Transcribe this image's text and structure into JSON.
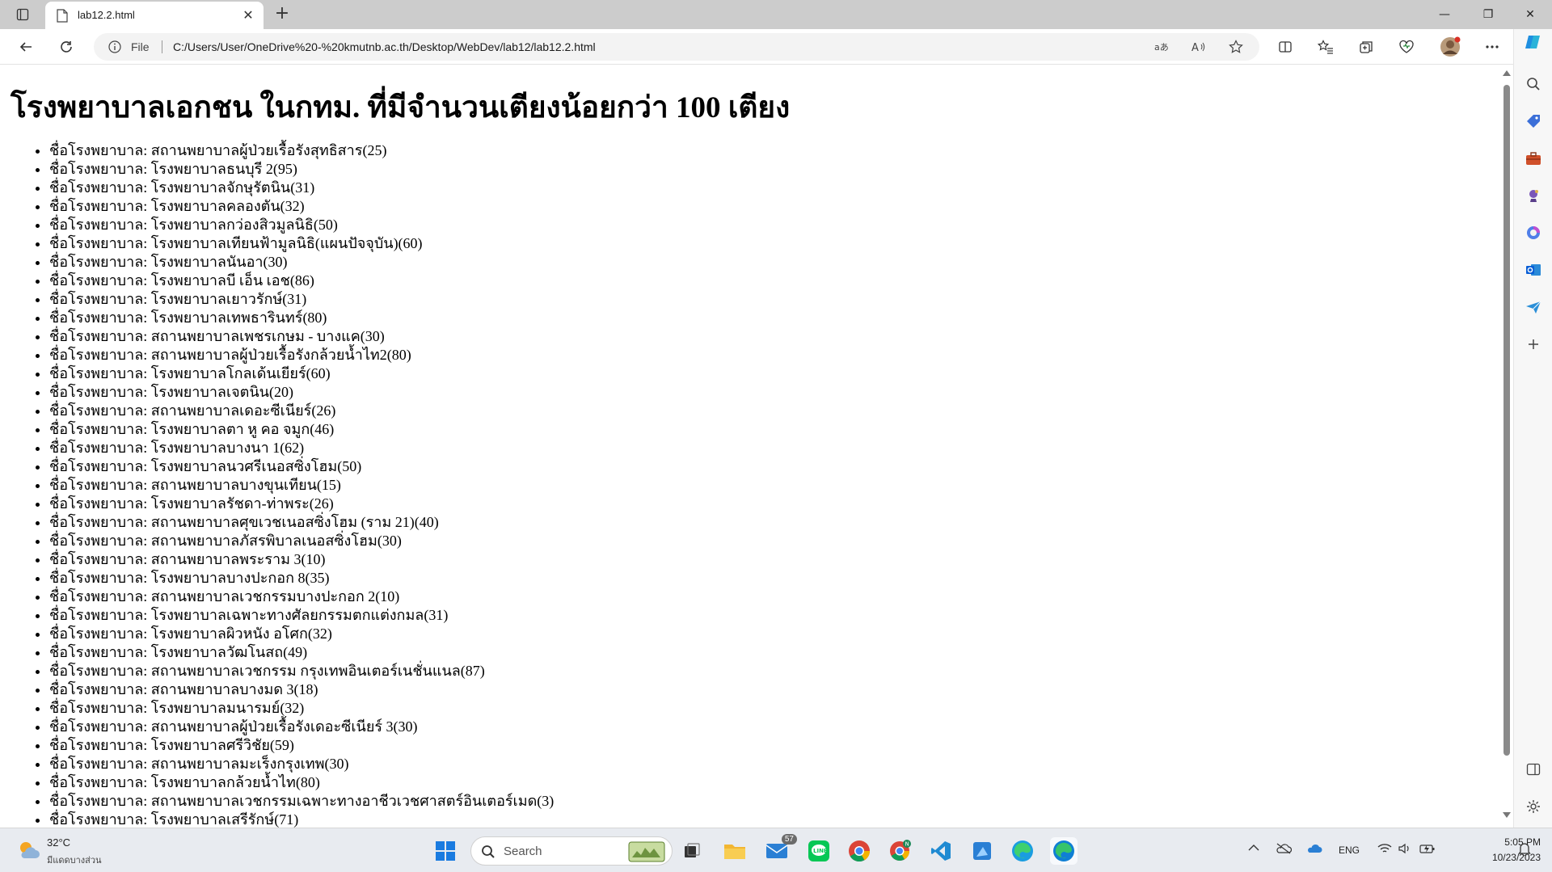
{
  "tab": {
    "title": "lab12.2.html",
    "close_glyph": "✕",
    "newtab_glyph": "+"
  },
  "window_controls": {
    "minimize": "—",
    "restore": "❐",
    "close": "✕"
  },
  "address_bar": {
    "scheme_label": "File",
    "url": "C:/Users/User/OneDrive%20-%20kmutnb.ac.th/Desktop/WebDev/lab12/lab12.2.html",
    "translate_label": "aあ",
    "read_aloud_label": "A⁠ⁿ"
  },
  "page": {
    "heading": "โรงพยาบาลเอกชน ในกทม. ที่มีจำนวนเตียงน้อยกว่า 100 เตียง",
    "item_prefix": "ชื่อโรงพยาบาล: ",
    "items": [
      "สถานพยาบาลผู้ป่วยเรื้อรังสุทธิสาร(25)",
      "โรงพยาบาลธนบุรี 2(95)",
      "โรงพยาบาลจักษุรัตนิน(31)",
      "โรงพยาบาลคลองตัน(32)",
      "โรงพยาบาลกว่องสิวมูลนิธิ(50)",
      "โรงพยาบาลเทียนฟ้ามูลนิธิ(แผนปัจจุบัน)(60)",
      "โรงพยาบาลนันอา(30)",
      "โรงพยาบาลบี เอ็น เอช(86)",
      "โรงพยาบาลเยาวรักษ์(31)",
      "โรงพยาบาลเทพธารินทร์(80)",
      "สถานพยาบาลเพชรเกษม - บางแค(30)",
      "สถานพยาบาลผู้ป่วยเรื้อรังกล้วยน้ำไท2(80)",
      "โรงพยาบาลโกลเด้นเยียร์(60)",
      "โรงพยาบาลเจตนิน(20)",
      "สถานพยาบาลเดอะซีเนียร์(26)",
      "โรงพยาบาลตา หู คอ จมูก(46)",
      "โรงพยาบาลบางนา 1(62)",
      "โรงพยาบาลนวศรีเนอสซิ่งโฮม(50)",
      "สถานพยาบาลบางขุนเทียน(15)",
      "โรงพยาบาลรัชดา-ท่าพระ(26)",
      "สถานพยาบาลศุขเวชเนอสซิ่งโฮม (ราม 21)(40)",
      "สถานพยาบาลภัสรพิบาลเนอสซิ่งโฮม(30)",
      "สถานพยาบาลพระราม 3(10)",
      "โรงพยาบาลบางปะกอก 8(35)",
      "สถานพยาบาลเวชกรรมบางปะกอก 2(10)",
      "โรงพยาบาลเฉพาะทางศัลยกรรมตกแต่งกมล(31)",
      "โรงพยาบาลผิวหนัง อโศก(32)",
      "โรงพยาบาลวัฒโนสถ(49)",
      "สถานพยาบาลเวชกรรม กรุงเทพอินเตอร์เนชั่นแนล(87)",
      "สถานพยาบาลบางมด 3(18)",
      "โรงพยาบาลมนารมย์(32)",
      "สถานพยาบาลผู้ป่วยเรื้อรังเดอะซีเนียร์ 3(30)",
      "โรงพยาบาลศรีวิชัย(59)",
      "สถานพยาบาลมะเร็งกรุงเทพ(30)",
      "โรงพยาบาลกล้วยน้ำไท(80)",
      "สถานพยาบาลเวชกรรมเฉพาะทางอาชีวเวชศาสตร์อินเตอร์เมด(3)",
      "โรงพยาบาลเสรีรักษ์(71)"
    ]
  },
  "taskbar": {
    "weather_temp": "32°C",
    "weather_desc": "มีแดดบางส่วน",
    "search_label": "Search",
    "mail_badge": "57",
    "language": "ENG",
    "time": "5:05 PM",
    "date": "10/23/2023"
  },
  "colors": {
    "tabbar_bg": "#cccccc",
    "accent": "#0a5fd6",
    "taskbar_bg": "#e8ebf0"
  }
}
